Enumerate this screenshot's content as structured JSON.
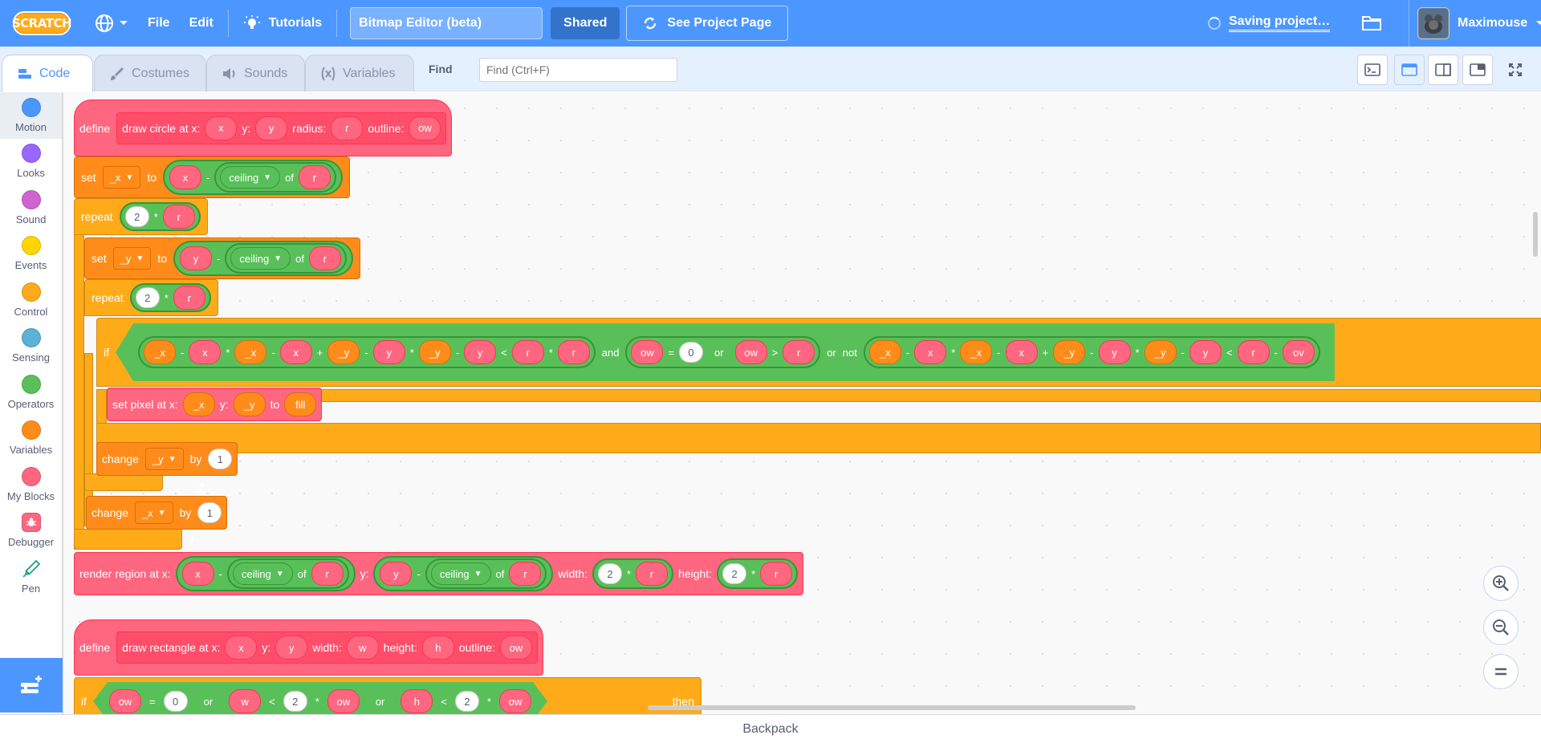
{
  "menubar": {
    "logo": "SCRATCH",
    "file": "File",
    "edit": "Edit",
    "tutorials": "Tutorials",
    "project_title": "Bitmap Editor (beta)",
    "shared": "Shared",
    "see_project": "See Project Page",
    "saving": "Saving project…",
    "username": "Maximouse"
  },
  "tabs": {
    "code": "Code",
    "costumes": "Costumes",
    "sounds": "Sounds",
    "variables": "Variables",
    "find_label": "Find",
    "find_placeholder": "Find (Ctrl+F)"
  },
  "categories": [
    {
      "label": "Motion",
      "color": "#4c97ff"
    },
    {
      "label": "Looks",
      "color": "#9966ff"
    },
    {
      "label": "Sound",
      "color": "#cf63cf"
    },
    {
      "label": "Events",
      "color": "#ffd500"
    },
    {
      "label": "Control",
      "color": "#ffab19"
    },
    {
      "label": "Sensing",
      "color": "#5cb1d6"
    },
    {
      "label": "Operators",
      "color": "#59c059"
    },
    {
      "label": "Variables",
      "color": "#ff8c1a"
    },
    {
      "label": "My Blocks",
      "color": "#ff6680"
    },
    {
      "label": "Debugger",
      "color": "#ff6680"
    },
    {
      "label": "Pen",
      "color": "#0fbd8c"
    }
  ],
  "script1": {
    "define": "define",
    "proto_name": "draw circle at x:",
    "arg_x": "x",
    "lbl_y": "y:",
    "arg_y": "y",
    "lbl_radius": "radius:",
    "arg_r": "r",
    "lbl_outline": "outline:",
    "arg_ow": "ow",
    "set": "set",
    "var_x": "_x",
    "var_y": "_y",
    "to": "to",
    "minus": "-",
    "times": "*",
    "plus": "+",
    "lt": "<",
    "gt": ">",
    "eq": "=",
    "ceiling": "ceiling",
    "of": "of",
    "repeat": "repeat",
    "two": "2",
    "if": "if",
    "and": "and",
    "or": "or",
    "not": "not",
    "zero": "0",
    "setpixel": "set pixel at x:",
    "setpixel_y": "y:",
    "setpixel_to": "to",
    "fill": "fill",
    "change": "change",
    "by": "by",
    "one": "1",
    "render": "render region at x:",
    "render_y": "y:",
    "render_w": "width:",
    "render_h": "height:",
    "ow_cut": "ov"
  },
  "script2": {
    "define": "define",
    "proto_name": "draw rectangle at x:",
    "arg_x": "x",
    "lbl_y": "y:",
    "arg_y": "y",
    "lbl_w": "width:",
    "arg_w": "w",
    "lbl_h": "height:",
    "arg_h": "h",
    "lbl_outline": "outline:",
    "arg_ow": "ow",
    "if": "if",
    "eq": "=",
    "zero": "0",
    "or": "or",
    "lt": "<",
    "two": "2",
    "times": "*",
    "then": "then"
  },
  "backpack": "Backpack"
}
